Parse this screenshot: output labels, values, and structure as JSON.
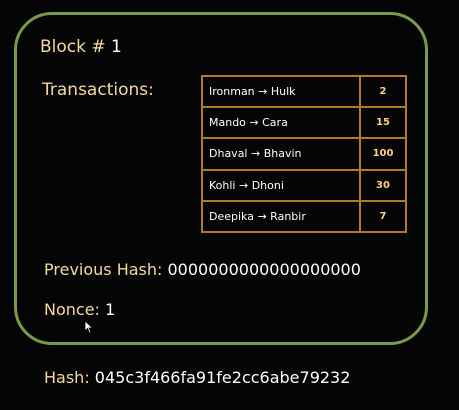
{
  "block": {
    "title_prefix": "Block #",
    "number": "1",
    "transactions_label": "Transactions:",
    "transactions": [
      {
        "text": "Ironman → Hulk",
        "amount": "2"
      },
      {
        "text": "Mando → Cara",
        "amount": "15"
      },
      {
        "text": "Dhaval → Bhavin",
        "amount": "100"
      },
      {
        "text": "Kohli → Dhoni",
        "amount": "30"
      },
      {
        "text": "Deepika → Ranbir",
        "amount": "7"
      }
    ],
    "previous_hash_label": "Previous Hash:",
    "previous_hash": "0000000000000000000",
    "nonce_label": "Nonce:",
    "nonce": "1"
  },
  "hash_label": "Hash:",
  "hash": "045c3f466fa91fe2cc6abe79232",
  "colors": {
    "border": "#7a9a4a",
    "table_border": "#b07a2a",
    "label": "#f4d9a0",
    "amount": "#ffd27a"
  },
  "icons": {
    "cursor": "mouse-pointer-icon"
  }
}
